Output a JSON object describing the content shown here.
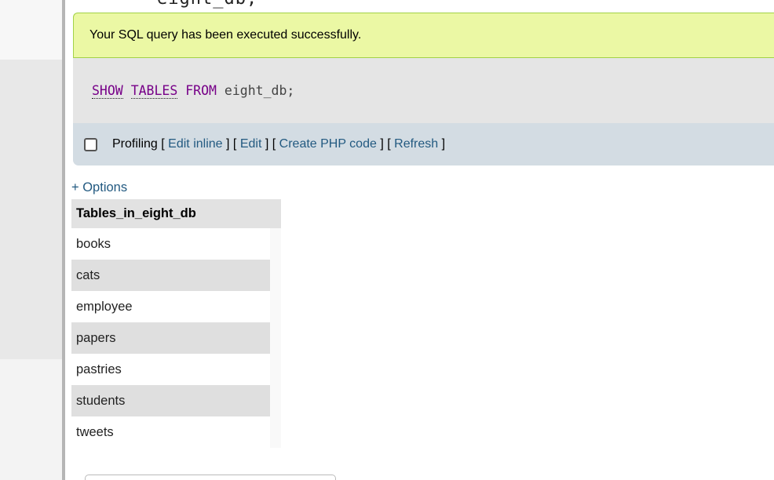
{
  "top_cut_text": "eight_db;",
  "success_message": "Your SQL query has been executed successfully.",
  "sql": {
    "kw_show": "SHOW",
    "kw_tables": "TABLES",
    "kw_from": "FROM",
    "db_name": "eight_db;"
  },
  "profiling": {
    "label": "Profiling",
    "open_bracket": "[",
    "close_bracket": "]",
    "edit_inline": "Edit inline",
    "edit": "Edit",
    "create_php_code": "Create PHP code",
    "refresh": "Refresh"
  },
  "options_link": "+ Options",
  "table": {
    "header": "Tables_in_eight_db",
    "rows": [
      "books",
      "cats",
      "employee",
      "papers",
      "pastries",
      "students",
      "tweets"
    ]
  },
  "colors": {
    "success_bg": "#ebf8a4",
    "success_border": "#a2d246",
    "sql_keyword": "#770088",
    "link": "#235a81",
    "profiling_bg": "#d3dce3"
  }
}
